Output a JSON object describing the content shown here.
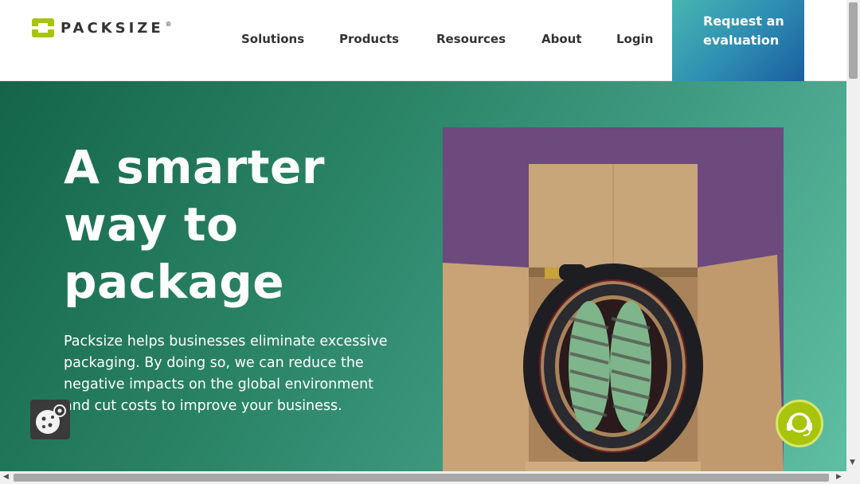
{
  "brand": {
    "name": "PACKSIZE",
    "trademark": "®",
    "logo_color": "#a9c40c"
  },
  "nav": {
    "items": [
      {
        "label": "Solutions"
      },
      {
        "label": "Products"
      },
      {
        "label": "Resources"
      },
      {
        "label": "About"
      },
      {
        "label": "Login"
      }
    ],
    "cta_label": "Request an evaluation"
  },
  "hero": {
    "title": "A smarter way to package",
    "body": "Packsize helps businesses eliminate excessive packaging. By doing so, we can reduce the negative impacts on the global environment and cut costs to improve your business.",
    "image_description_icon": "box-with-hose-image"
  },
  "widgets": {
    "cookie_icon": "cookie-settings-icon",
    "chat_icon": "chat-headset-icon"
  },
  "colors": {
    "hero_dark": "#14654a",
    "hero_light": "#5fbfa2",
    "cta_start": "#47b6b0",
    "cta_end": "#1a5fa0",
    "accent_green": "#a9c40c",
    "image_bg": "#6c4a7e"
  }
}
